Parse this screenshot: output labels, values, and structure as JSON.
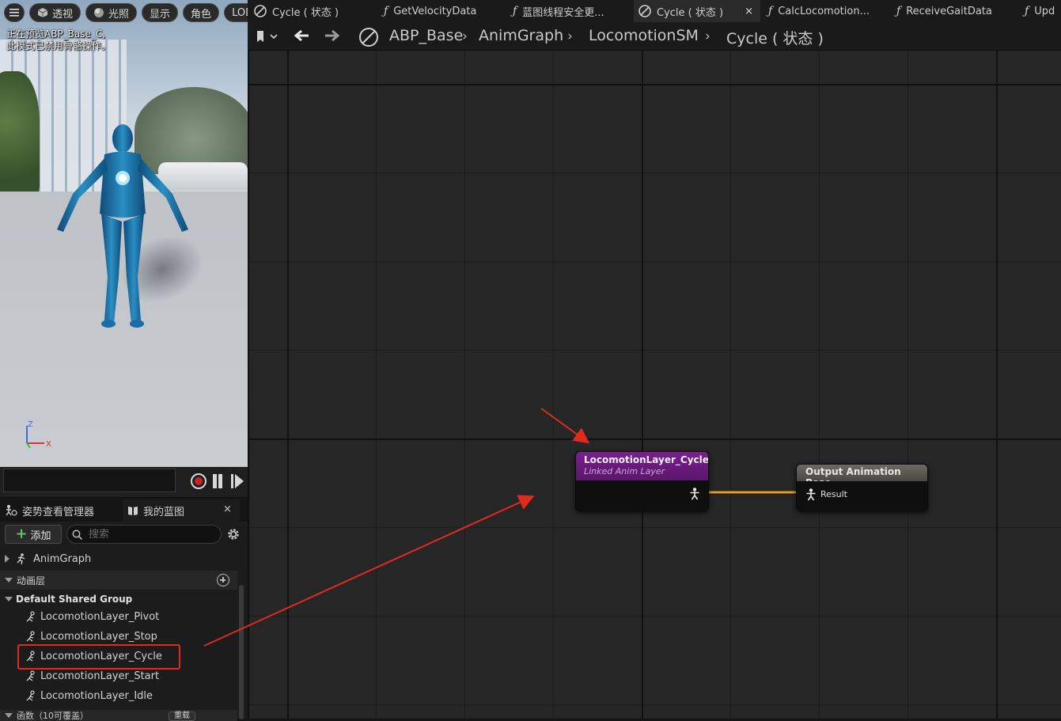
{
  "viewport": {
    "toolbar": {
      "perspective": "透视",
      "lighting": "光照",
      "show": "显示",
      "character": "角色",
      "lod": "LOD"
    },
    "note_line1": "正在预览ABP_Base_C,",
    "note_line2": "此模式已禁用骨骼操作。",
    "axis_z": "Z",
    "axis_x": "X"
  },
  "left_panel": {
    "tab_pose": "姿势查看管理器",
    "tab_blueprint": "我的蓝图",
    "close": "×",
    "add_label": "添加",
    "search_placeholder": "搜索",
    "animgraph": "AnimGraph",
    "anim_layers_section": "动画层",
    "group": "Default Shared Group",
    "layers": [
      "LocomotionLayer_Pivot",
      "LocomotionLayer_Stop",
      "LocomotionLayer_Cycle",
      "LocomotionLayer_Start",
      "LocomotionLayer_Idle"
    ],
    "functions_section": "函数（10可覆盖）",
    "reset": "重载"
  },
  "tabs": [
    {
      "label": "Cycle ( 状态 )",
      "icon": "state-icon"
    },
    {
      "label": "GetVelocityData",
      "icon": "function-icon"
    },
    {
      "label": "蓝图线程安全更...",
      "icon": "function-icon"
    },
    {
      "label": "Cycle ( 状态 )",
      "icon": "state-icon",
      "active": true
    },
    {
      "label": "CalcLocomotion...",
      "icon": "function-icon"
    },
    {
      "label": "ReceiveGaitData",
      "icon": "function-icon"
    },
    {
      "label": "Upd",
      "icon": "function-icon"
    }
  ],
  "tab_close": "×",
  "breadcrumb": {
    "root": "ABP_Base",
    "items": [
      "AnimGraph",
      "LocomotionSM",
      "Cycle ( 状态 )"
    ],
    "sep": "›"
  },
  "nodes": {
    "linked": {
      "title": "LocomotionLayer_Cycle",
      "subtitle": "Linked Anim Layer"
    },
    "output": {
      "title": "Output Animation Pose",
      "pin": "Result"
    }
  },
  "colors": {
    "linked_header": "#7a1f8e",
    "output_header": "#6e6a63",
    "wire": "#e0a030",
    "annotation": "#e02a20"
  }
}
